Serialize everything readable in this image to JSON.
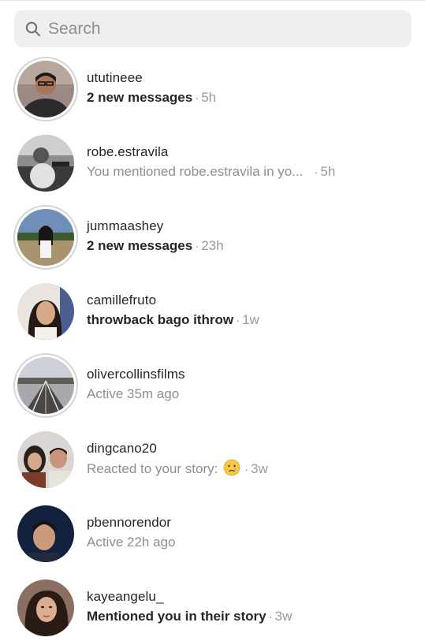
{
  "search": {
    "placeholder": "Search"
  },
  "conversations": [
    {
      "username": "ututineee",
      "message": "2 new messages",
      "time": "5h",
      "unread": true
    },
    {
      "username": "robe.estravila",
      "message": "You mentioned robe.estravila in yo...",
      "time": "5h",
      "unread": false
    },
    {
      "username": "jummaashey",
      "message": "2 new messages",
      "time": "23h",
      "unread": true
    },
    {
      "username": "camillefruto",
      "message": "throwback bago ithrow",
      "time": "1w",
      "unread": true
    },
    {
      "username": "olivercollinsfilms",
      "message": "Active 35m ago",
      "time": "",
      "unread": false
    },
    {
      "username": "dingcano20",
      "message": "Reacted to your story:",
      "time": "3w",
      "unread": false,
      "emoji": "crying-face-icon"
    },
    {
      "username": "pbennorendor",
      "message": "Active 22h ago",
      "time": "",
      "unread": false
    },
    {
      "username": "kayeangelu_",
      "message": "Mentioned you in their story",
      "time": "3w",
      "unread": true
    }
  ],
  "separator": "·",
  "colors": {
    "search_bg": "#efefef",
    "secondary_text": "#8e8e8e",
    "ring": "#d5d5d5"
  }
}
